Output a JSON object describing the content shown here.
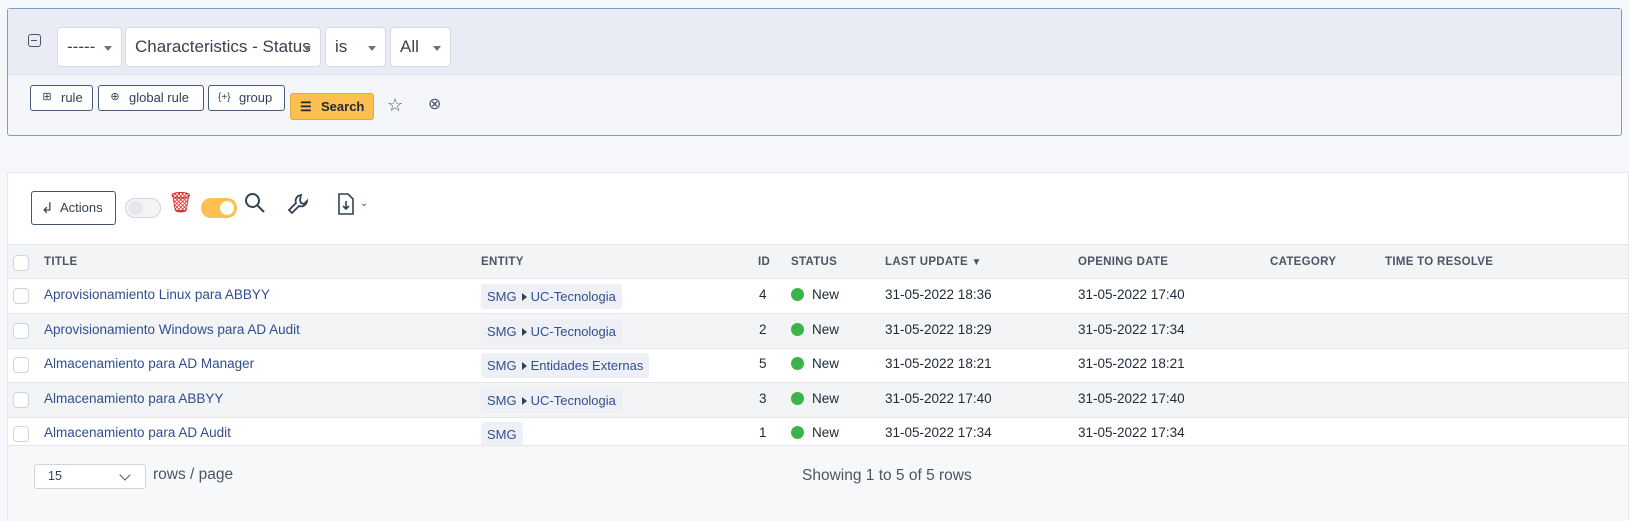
{
  "criteria": {
    "field1": "-----",
    "field2": "Characteristics - Status",
    "operator": "is",
    "value": "All",
    "buttons": {
      "rule": "rule",
      "global_rule": "global rule",
      "group": "group",
      "search": "Search"
    }
  },
  "toolbar": {
    "actions_label": "Actions"
  },
  "table": {
    "headers": {
      "title": "TITLE",
      "entity": "ENTITY",
      "id": "ID",
      "status": "STATUS",
      "last_update": "LAST UPDATE",
      "opening_date": "OPENING DATE",
      "category": "CATEGORY",
      "time_to_resolve": "TIME TO RESOLVE"
    },
    "rows": [
      {
        "title": "Aprovisionamiento Linux para ABBYY",
        "entity_root": "SMG",
        "entity_child": "UC-Tecnologia",
        "id": "4",
        "status": "New",
        "last_update": "31-05-2022 18:36",
        "opening_date": "31-05-2022 17:40"
      },
      {
        "title": "Aprovisionamiento Windows para AD Audit",
        "entity_root": "SMG",
        "entity_child": "UC-Tecnologia",
        "id": "2",
        "status": "New",
        "last_update": "31-05-2022 18:29",
        "opening_date": "31-05-2022 17:34"
      },
      {
        "title": "Almacenamiento para AD Manager",
        "entity_root": "SMG",
        "entity_child": "Entidades Externas",
        "id": "5",
        "status": "New",
        "last_update": "31-05-2022 18:21",
        "opening_date": "31-05-2022 18:21"
      },
      {
        "title": "Almacenamiento para ABBYY",
        "entity_root": "SMG",
        "entity_child": "UC-Tecnologia",
        "id": "3",
        "status": "New",
        "last_update": "31-05-2022 17:40",
        "opening_date": "31-05-2022 17:40"
      },
      {
        "title": "Almacenamiento para AD Audit",
        "entity_root": "SMG",
        "entity_child": "",
        "id": "1",
        "status": "New",
        "last_update": "31-05-2022 17:34",
        "opening_date": "31-05-2022 17:34"
      }
    ]
  },
  "pagination": {
    "per_page": "15",
    "per_page_label": "rows / page",
    "showing": "Showing 1 to 5 of 5 rows"
  },
  "colors": {
    "accent": "#fbc04f",
    "status_new": "#3cb44b",
    "delete": "#dc2626"
  }
}
